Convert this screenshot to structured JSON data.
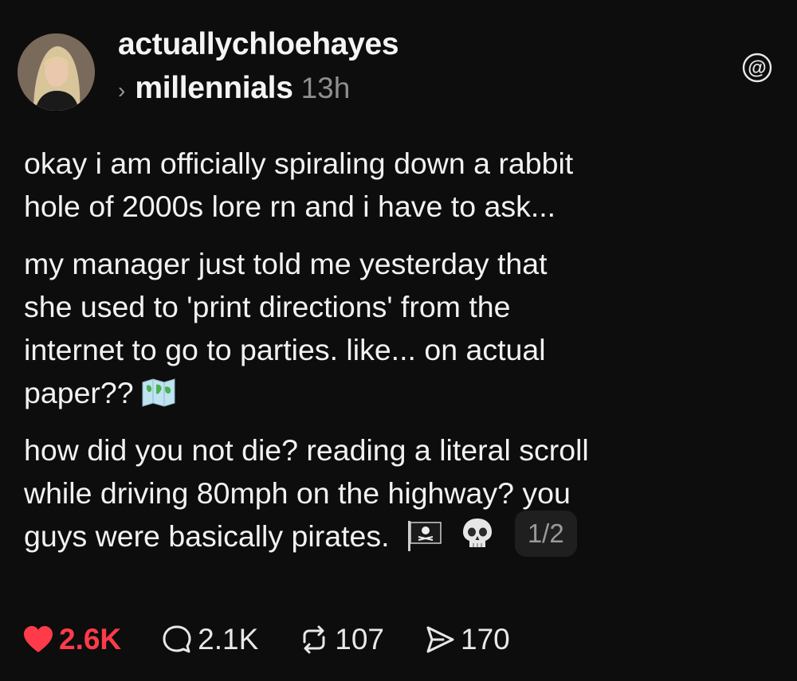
{
  "post": {
    "author": "actuallychloehayes",
    "community": "millennials",
    "time_ago": "13h",
    "paragraphs": [
      [
        "okay i am officially spiraling down a rabbit",
        "hole of 2000s lore rn and i have to ask..."
      ],
      [
        "my manager just told me yesterday that",
        "she used to 'print directions' from the",
        "internet to go to parties. like... on actual",
        "paper??"
      ],
      [
        "how did you not die? reading a literal scroll",
        "while driving 80mph on the highway? you",
        "guys were basically pirates."
      ]
    ],
    "emojis": [
      "world-map-icon",
      "pirate-flag-icon",
      "skull-icon"
    ],
    "page_indicator": "1/2"
  },
  "stats": {
    "likes": "2.6K",
    "replies": "2.1K",
    "reposts": "107",
    "shares": "170"
  },
  "colors": {
    "background": "#0d0d0d",
    "text": "#f2f2f2",
    "secondary": "#8e8e8e",
    "like_red": "#ff3b4a"
  }
}
